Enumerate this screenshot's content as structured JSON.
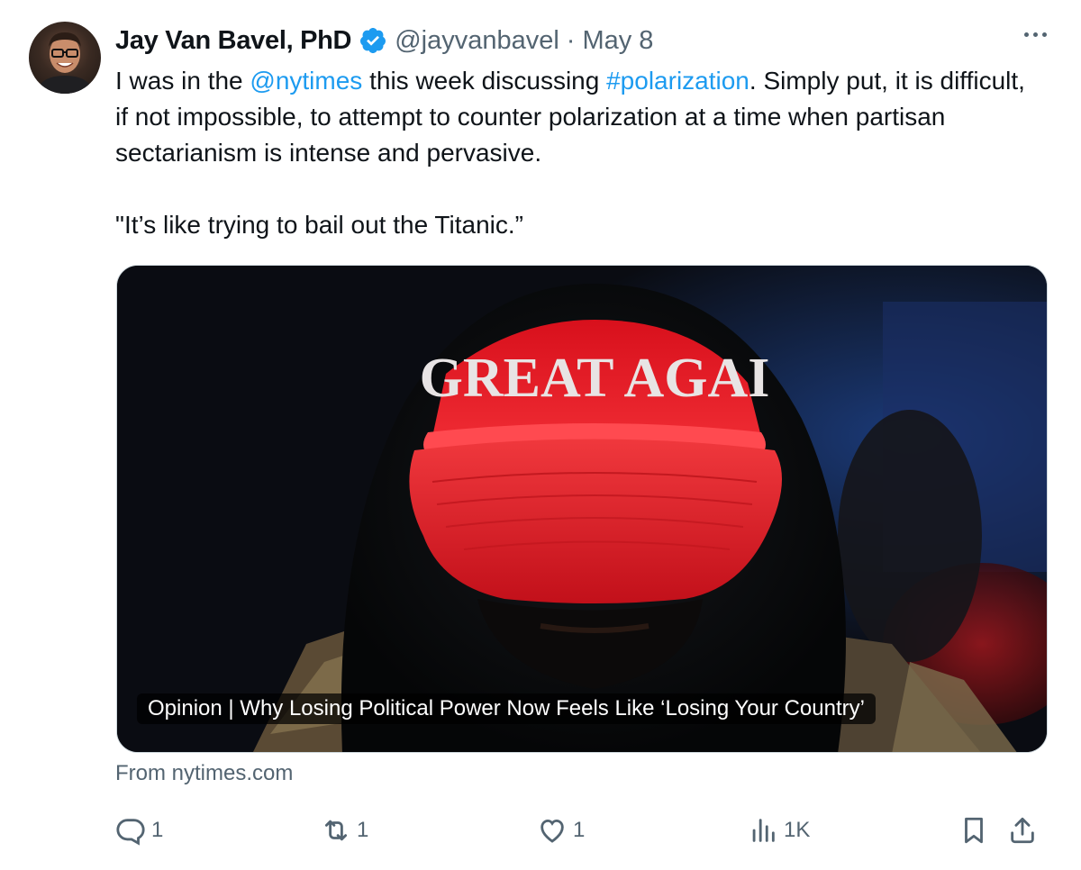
{
  "author": {
    "display_name": "Jay Van Bavel, PhD",
    "handle": "@jayvanbavel",
    "separator": "·",
    "date": "May 8",
    "verified": true,
    "verified_color": "#1d9bf0"
  },
  "body": {
    "line1_pre": "I was in the ",
    "mention": "@nytimes",
    "line1_mid": " this week discussing ",
    "hashtag": "#polarization",
    "line1_post": ". Simply put, it is difficult, if not impossible, to attempt to counter polarization at a time when partisan sectarianism is intense and pervasive.",
    "quote": "\"It’s like trying to bail out the Titanic.”",
    "link_color": "#1d9bf0"
  },
  "card": {
    "hat_text": "GREAT AGAI",
    "caption": "Opinion | Why Losing Political Power Now Feels Like ‘Losing Your Country’",
    "source": "From nytimes.com"
  },
  "actions": {
    "reply_count": "1",
    "repost_count": "1",
    "like_count": "1",
    "views_count": "1K"
  },
  "icons": [
    "verified-badge-icon",
    "more-icon",
    "reply-icon",
    "repost-icon",
    "like-icon",
    "views-icon",
    "bookmark-icon",
    "share-icon"
  ],
  "colors": {
    "text": "#0f1419",
    "secondary": "#536471",
    "accent": "#1d9bf0",
    "hat_red": "#e0141e"
  }
}
